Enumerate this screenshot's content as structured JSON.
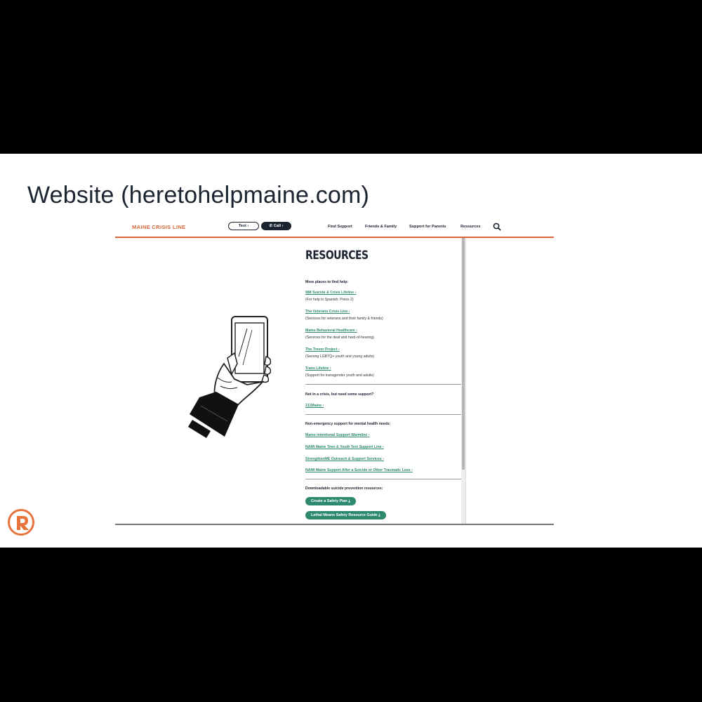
{
  "slide": {
    "title": "Website (heretohelpmaine.com)"
  },
  "site": {
    "brand": "MAINE CRISIS LINE",
    "text_button": "Text",
    "call_button": "Call",
    "nav": [
      "Find Support",
      "Friends & Family",
      "Support for Parents",
      "Resources"
    ]
  },
  "resources": {
    "heading": "RESOURCES",
    "section1": {
      "label": "More places to find help:",
      "items": [
        {
          "link": "988 Suicide & Crisis Lifeline",
          "desc": "(For help in Spanish: Press 2)"
        },
        {
          "link": "The Veterans Crisis Line",
          "desc": "(Services for veterans and their family & friends)"
        },
        {
          "link": "Maine Behavioral Healthcare",
          "desc": "(Services for the deaf and hard-of-hearing)"
        },
        {
          "link": "The Trevor Project",
          "desc": "(Serving LGBTQ+ youth and young adults)"
        },
        {
          "link": "Trans Lifeline",
          "desc": "(Support for transgender youth and adults)"
        }
      ]
    },
    "section2": {
      "label": "Not in a crisis, but need some support?",
      "items": [
        {
          "link": "211Maine"
        }
      ]
    },
    "section3": {
      "label": "Non-emergency support for mental health needs:",
      "items": [
        {
          "link": "Maine Intentional Support Warmline"
        },
        {
          "link": "NAMI Maine Teen & Youth Text Support Line"
        },
        {
          "link": "StrengthenME Outreach & Support Services"
        },
        {
          "link": "NAMI Maine Support After a Suicide or Other Traumatic Loss"
        }
      ]
    },
    "section4": {
      "label": "Downloadable suicide prevention resources:",
      "buttons": [
        "Create a Safety Plan",
        "Lethal Means Safety Resource Guide"
      ]
    }
  },
  "colors": {
    "brand_orange": "#d9693a",
    "navy": "#1c2331",
    "link_green": "#2e8a6e"
  },
  "icons": [
    "search-icon",
    "phone-icon",
    "download-icon",
    "chevron-right-icon",
    "logo-icon"
  ]
}
